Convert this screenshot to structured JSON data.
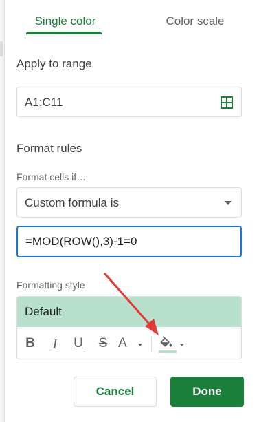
{
  "tabs": {
    "single_color": "Single color",
    "color_scale": "Color scale"
  },
  "apply_to_range": {
    "heading": "Apply to range",
    "value": "A1:C11",
    "icon": "grid-icon"
  },
  "format_rules": {
    "heading": "Format rules",
    "condition_label": "Format cells if…",
    "condition_value": "Custom formula is",
    "formula_value": "=MOD(ROW(),3)-1=0"
  },
  "formatting_style": {
    "label": "Formatting style",
    "preview_text": "Default",
    "preview_color": "#b7e1cd",
    "toolbar": {
      "bold": "B",
      "italic": "I",
      "underline": "U",
      "strikethrough": "S",
      "text_color": "A",
      "fill_color_icon": "paint-bucket-icon",
      "fill_color": "#b7e1cd"
    }
  },
  "actions": {
    "cancel": "Cancel",
    "done": "Done"
  },
  "colors": {
    "accent_green": "#188038",
    "focus_blue": "#1a73e8",
    "annotation_arrow": "#e53935"
  }
}
